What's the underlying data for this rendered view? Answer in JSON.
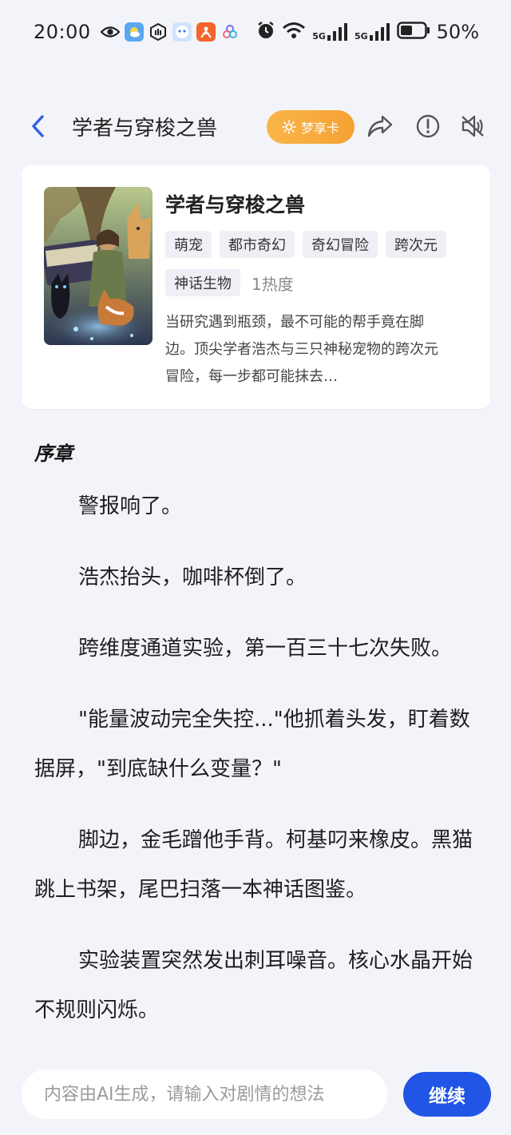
{
  "status_bar": {
    "time": "20:00",
    "battery": "50%",
    "network_1": "5G",
    "network_2": "5G",
    "icons": [
      "eye-icon",
      "weather-app-icon",
      "hand-app-icon",
      "assistant-app-icon",
      "orange-app-icon",
      "cluster-app-icon",
      "alarm-icon",
      "wifi-icon",
      "signal-icon",
      "battery-icon"
    ]
  },
  "nav": {
    "title": "学者与穿梭之兽",
    "vip_label": "梦享卡",
    "icons": [
      "back-icon",
      "sun-icon",
      "share-icon",
      "report-icon",
      "mute-icon"
    ]
  },
  "book": {
    "title": "学者与穿梭之兽",
    "tags": [
      "萌宠",
      "都市奇幻",
      "奇幻冒险",
      "跨次元",
      "神话生物"
    ],
    "heat": "1热度",
    "description": "当研究遇到瓶颈，最不可能的帮手竟在脚边。顶尖学者浩杰与三只神秘宠物的跨次元冒险，每一步都可能抹去…"
  },
  "story": {
    "chapter": "序章",
    "paragraphs": [
      "警报响了。",
      "浩杰抬头，咖啡杯倒了。",
      "跨维度通道实验，第一百三十七次失败。",
      "\"能量波动完全失控...\"他抓着头发，盯着数据屏，\"到底缺什么变量？\"",
      "脚边，金毛蹭他手背。柯基叼来橡皮。黑猫跳上书架，尾巴扫落一本神话图鉴。",
      "实验装置突然发出刺耳噪音。核心水晶开始不规则闪烁。"
    ]
  },
  "input": {
    "placeholder": "内容由AI生成，请输入对剧情的想法",
    "value": "",
    "button_label": "继续"
  },
  "colors": {
    "background": "#f3f4f9",
    "accent": "#2155e6",
    "vip_orange": "#f6a233"
  }
}
